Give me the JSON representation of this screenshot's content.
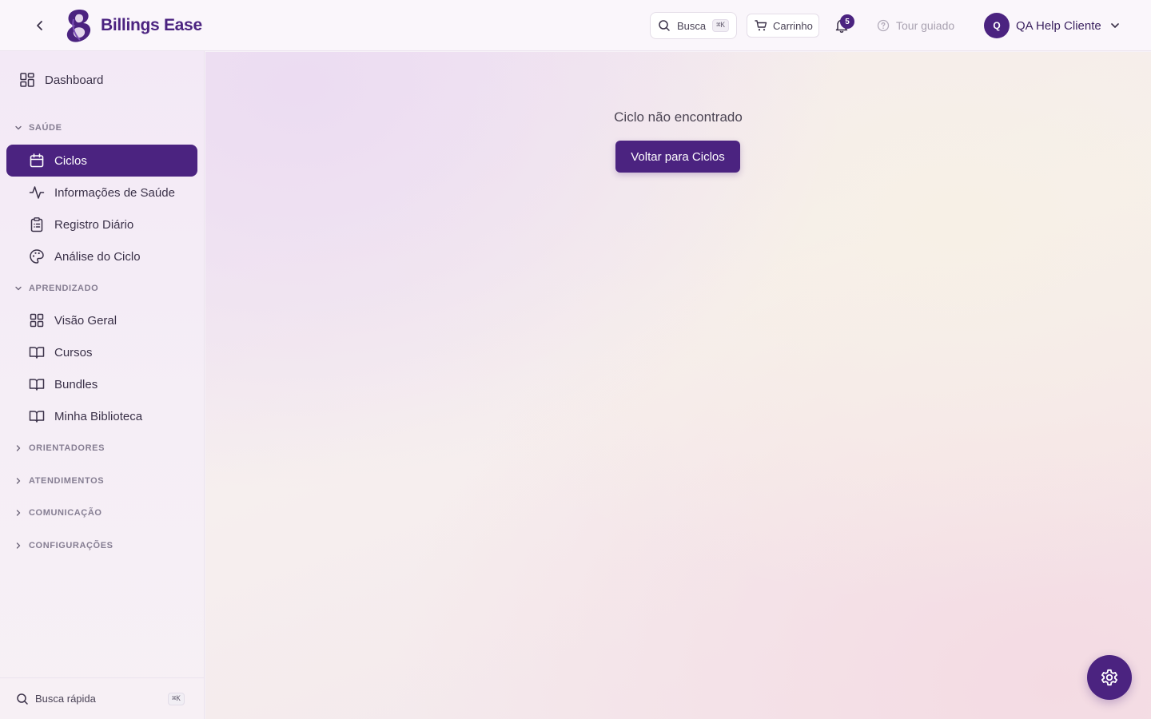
{
  "brand": {
    "name": "Billings Ease",
    "color": "#4b2380"
  },
  "header": {
    "search_label": "Busca",
    "search_shortcut": "⌘K",
    "cart_label": "Carrinho",
    "notifications_count": "5",
    "tour_label": "Tour guiado",
    "user": {
      "initial": "Q",
      "name": "QA Help Cliente"
    }
  },
  "sidebar": {
    "dashboard": "Dashboard",
    "sections": {
      "saude": "SAÚDE",
      "aprendizado": "APRENDIZADO",
      "orientadores": "ORIENTADORES",
      "atendimentos": "ATENDIMENTOS",
      "comunicacao": "COMUNICAÇÃO",
      "configuracoes": "CONFIGURAÇÕES"
    },
    "saude_items": [
      "Ciclos",
      "Informações de Saúde",
      "Registro Diário",
      "Análise do Ciclo"
    ],
    "aprendizado_items": [
      "Visão Geral",
      "Cursos",
      "Bundles",
      "Minha Biblioteca"
    ],
    "quick_search": "Busca rápida",
    "quick_search_shortcut": "⌘K"
  },
  "main": {
    "message": "Ciclo não encontrado",
    "back_button": "Voltar para Ciclos"
  },
  "icons": {
    "back": "chevron-left-icon",
    "search": "search-icon",
    "cart": "cart-icon",
    "bell": "bell-icon",
    "help": "help-circle-icon",
    "settings": "gear-icon"
  }
}
